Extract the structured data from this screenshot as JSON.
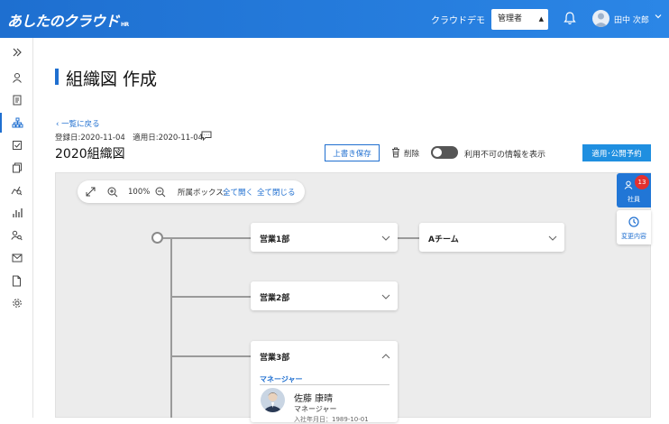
{
  "header": {
    "logo_text": "あしたのクラウド",
    "logo_sub": "HR",
    "company_name": "クラウドデモ",
    "role_selected": "管理者",
    "user_name": "田中 次郎"
  },
  "sidebar": {
    "items": [
      {
        "icon": "expand-icon"
      },
      {
        "icon": "person-icon"
      },
      {
        "icon": "document-icon"
      },
      {
        "icon": "org-chart-icon",
        "active": true
      },
      {
        "icon": "checklist-icon"
      },
      {
        "icon": "copy-icon"
      },
      {
        "icon": "analytics-icon"
      },
      {
        "icon": "bar-chart-icon"
      },
      {
        "icon": "user-search-icon"
      },
      {
        "icon": "mail-icon"
      },
      {
        "icon": "file-icon"
      },
      {
        "icon": "gear-icon"
      }
    ]
  },
  "page": {
    "title": "組織図 作成",
    "back_link": "一覧に戻る",
    "dates": "登録日:2020-11-04　適用日:2020-11-04",
    "org_name": "2020組織図"
  },
  "actions": {
    "save_label": "上書き保存",
    "delete_label": "削除",
    "toggle_label": "利用不可の情報を表示",
    "toggle_on": false,
    "publish_label": "適用･公開予約"
  },
  "toolbar": {
    "zoom": "100%",
    "box_label": "所属ボックス:",
    "open_all": "全て開く",
    "close_all": "全て閉じる"
  },
  "nodes": {
    "dept1": "営業1部",
    "team_a": "Aチーム",
    "dept2": "営業2部",
    "dept3": "営業3部",
    "manager_heading": "マネージャー",
    "manager_name": "佐藤 康晴",
    "manager_role": "マネージャー",
    "manager_date": "入社年月日：1989-10-01"
  },
  "side_panel": {
    "employees_label": "社員",
    "employees_count": "13",
    "changes_label": "変更内容"
  },
  "colors": {
    "brand": "#1f6fd0",
    "header_gradient": [
      "#1e6fd0",
      "#2b86e6"
    ],
    "publish_button": "#1f8fe0",
    "badge": "#e4312f"
  }
}
